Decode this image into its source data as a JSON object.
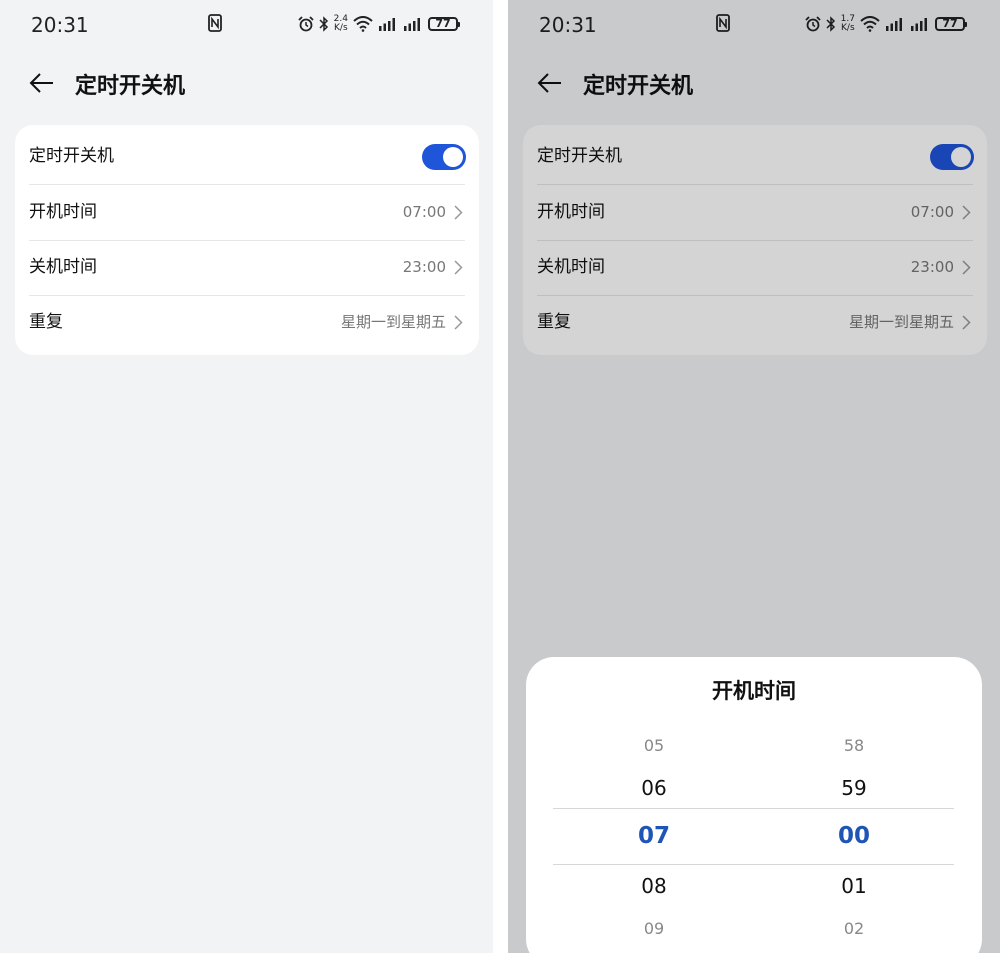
{
  "status_bar": {
    "time": "20:31",
    "left_speed_top": "2.4",
    "left_speed_bottom": "K/s",
    "right_speed_top": "1.7",
    "right_speed_bottom": "K/s",
    "battery": "77"
  },
  "page": {
    "title": "定时开关机",
    "rows": [
      {
        "label": "定时开关机",
        "toggle_on": true
      },
      {
        "label": "开机时间",
        "value": "07:00"
      },
      {
        "label": "关机时间",
        "value": "23:00"
      },
      {
        "label": "重复",
        "value": "星期一到星期五"
      }
    ]
  },
  "picker_sheet": {
    "title": "开机时间",
    "hours": [
      "05",
      "06",
      "07",
      "08",
      "09"
    ],
    "minutes": [
      "58",
      "59",
      "00",
      "01",
      "02"
    ],
    "selected_hour": "07",
    "selected_minute": "00"
  },
  "colors": {
    "accent": "#1f55d9",
    "selected_text": "#1f55b6",
    "background": "#f1f3f5"
  }
}
